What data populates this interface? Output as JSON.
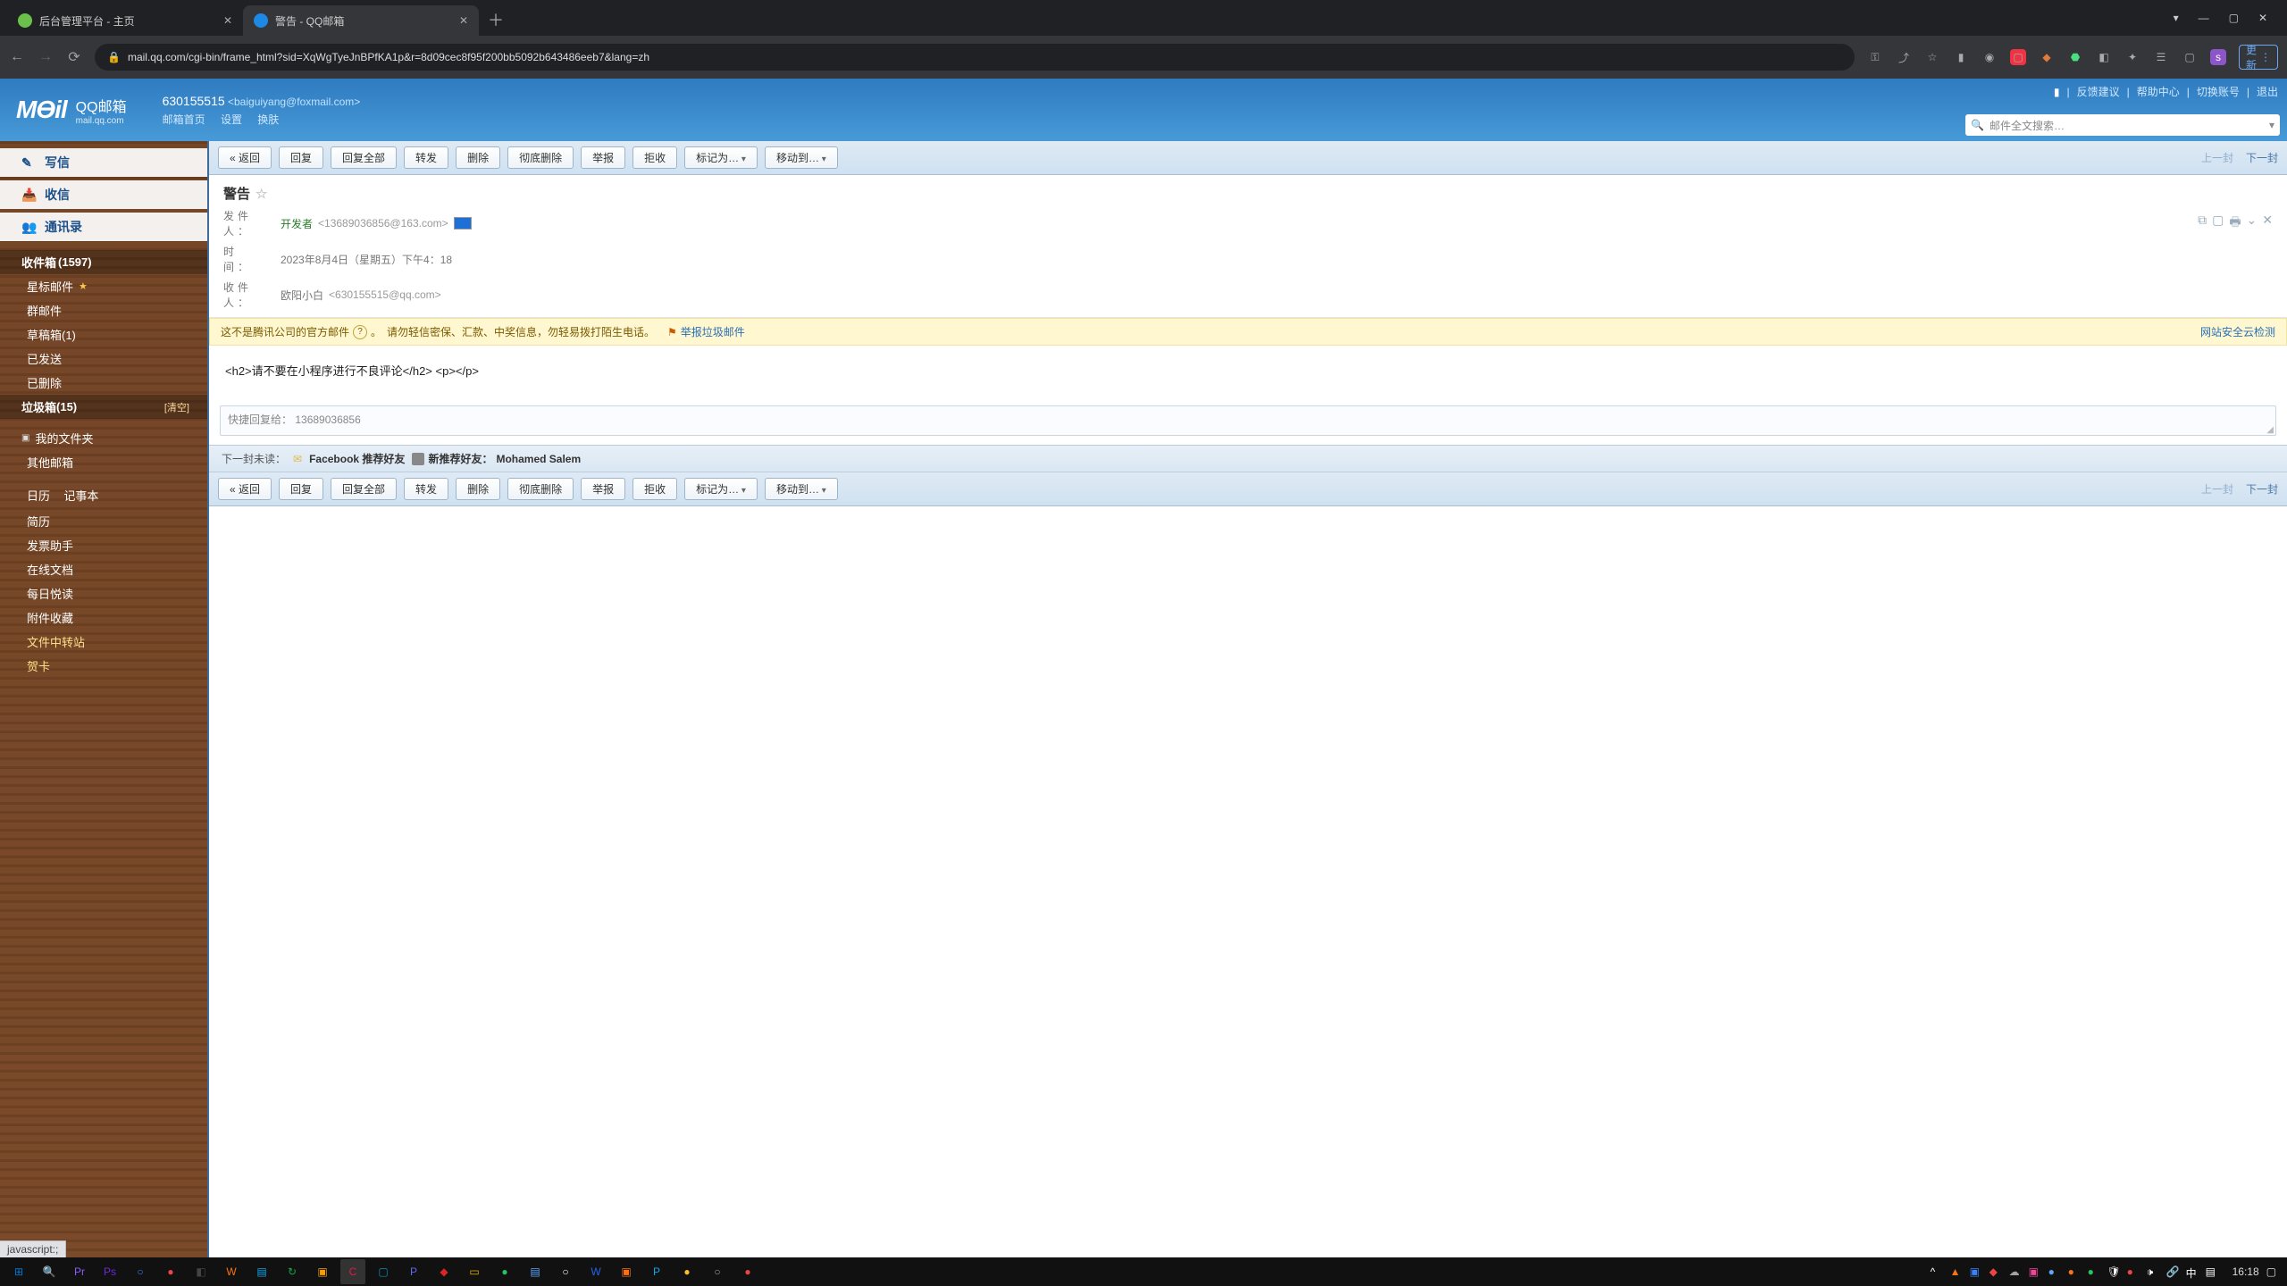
{
  "browser": {
    "tabs": [
      {
        "title": "后台管理平台 - 主页",
        "fav_color": "#6bc04b"
      },
      {
        "title": "警告 - QQ邮箱",
        "fav_color": "#1e88e5"
      }
    ],
    "active_tab": 1,
    "url": "mail.qq.com/cgi-bin/frame_html?sid=XqWgTyeJnBPfKA1p&r=8d09cec8f95f200bb5092b643486eeb7&lang=zh",
    "update_label": "更新",
    "avatar_letter": "s",
    "window_controls": {
      "min": "—",
      "max": "▢",
      "close": "✕",
      "menu": "▾"
    }
  },
  "qqheader": {
    "logo_main": "MƟil",
    "logo_cn": "QQ邮箱",
    "logo_sub": "mail.qq.com",
    "account_id": "630155515",
    "account_email": "<baiguiyang@foxmail.com>",
    "links": [
      "邮箱首页",
      "设置",
      "换肤"
    ],
    "right_links": [
      "反馈建议",
      "帮助中心",
      "切换账号",
      "退出"
    ],
    "search_placeholder": "邮件全文搜索…"
  },
  "sidebar": {
    "compose": "写信",
    "receive": "收信",
    "contacts": "通讯录",
    "inbox": {
      "label": "收件箱",
      "count": "(1597)"
    },
    "items": [
      {
        "label": "星标邮件",
        "star": true
      },
      {
        "label": "群邮件"
      },
      {
        "label": "草稿箱(1)"
      },
      {
        "label": "已发送"
      },
      {
        "label": "已删除"
      }
    ],
    "junk": {
      "label": "垃圾箱",
      "count": "(15)",
      "clear": "[清空]"
    },
    "myfolders": "我的文件夹",
    "other_mail": "其他邮箱",
    "calendar": "日历",
    "notes": "记事本",
    "links": [
      "简历",
      "发票助手",
      "在线文档",
      "每日悦读",
      "附件收藏",
      "文件中转站",
      "贺卡"
    ]
  },
  "toolbar": {
    "back": "« 返回",
    "buttons": [
      "回复",
      "回复全部",
      "转发",
      "删除",
      "彻底删除",
      "举报",
      "拒收"
    ],
    "mark": "标记为…",
    "move": "移动到…",
    "prev": "上一封",
    "next": "下一封"
  },
  "message": {
    "subject": "警告",
    "from_label": "发件人：",
    "from_name": "开发者",
    "from_addr": "<13689036856@163.com>",
    "date_label": "时　间：",
    "date": "2023年8月4日（星期五）下午4：18",
    "to_label": "收件人：",
    "to_name": "欧阳小白",
    "to_addr": "<630155515@qq.com>",
    "warn1": "这不是腾讯公司的官方邮件",
    "warn_q": "?",
    "warn2": "。　请勿轻信密保、汇款、中奖信息，勿轻易拨打陌生电话。",
    "warn_flag": "⚑",
    "warn_report": "举报垃圾邮件",
    "warn_right": "网站安全云检测",
    "body": "<h2>请不要在小程序进行不良评论</h2> <p></p>",
    "quick_reply_prefix": "快捷回复给：",
    "quick_reply_to": "13689036856",
    "next_unread_label": "下一封未读：",
    "next_unread_1": "Facebook 推荐好友",
    "next_unread_2_lbl": "新推荐好友：",
    "next_unread_2_name": "Mohamed Salem"
  },
  "statusbar": "javascript:;",
  "taskbar": {
    "apps": [
      {
        "c": "#0078d7",
        "t": "⊞"
      },
      {
        "c": "#fff",
        "t": "🔍"
      },
      {
        "c": "#8b5cf6",
        "t": "Pr"
      },
      {
        "c": "#6d28d9",
        "t": "Ps"
      },
      {
        "c": "#3b82f6",
        "t": "○"
      },
      {
        "c": "#ef4444",
        "t": "●"
      },
      {
        "c": "#444",
        "t": "◧"
      },
      {
        "c": "#f97316",
        "t": "W"
      },
      {
        "c": "#0ea5e9",
        "t": "▤"
      },
      {
        "c": "#16a34a",
        "t": "↻"
      },
      {
        "c": "#f59e0b",
        "t": "▣"
      },
      {
        "c": "#e11d48",
        "t": "C"
      },
      {
        "c": "#0891b2",
        "t": "▢"
      },
      {
        "c": "#6366f1",
        "t": "P"
      },
      {
        "c": "#dc2626",
        "t": "◆"
      },
      {
        "c": "#eab308",
        "t": "▭"
      },
      {
        "c": "#22c55e",
        "t": "●"
      },
      {
        "c": "#60a5fa",
        "t": "▤"
      },
      {
        "c": "#fff",
        "t": "○"
      },
      {
        "c": "#2563eb",
        "t": "W"
      },
      {
        "c": "#f97316",
        "t": "▣"
      },
      {
        "c": "#0ea5e9",
        "t": "P"
      },
      {
        "c": "#fbbf24",
        "t": "●"
      },
      {
        "c": "#a3a3a3",
        "t": "○"
      },
      {
        "c": "#ef4444",
        "t": "●"
      }
    ],
    "tray": [
      {
        "c": "#fff",
        "t": "^"
      },
      {
        "c": "#f97316",
        "t": "▲"
      },
      {
        "c": "#3b82f6",
        "t": "▣"
      },
      {
        "c": "#ef4444",
        "t": "◆"
      },
      {
        "c": "#a3a3a3",
        "t": "☁"
      },
      {
        "c": "#ec4899",
        "t": "▣"
      },
      {
        "c": "#60a5fa",
        "t": "●"
      },
      {
        "c": "#f97316",
        "t": "●"
      },
      {
        "c": "#22c55e",
        "t": "●"
      },
      {
        "c": "#fff",
        "t": "🛡"
      },
      {
        "c": "#ef4444",
        "t": "●"
      },
      {
        "c": "#fff",
        "t": "🕩"
      },
      {
        "c": "#fff",
        "t": "🔗"
      },
      {
        "c": "#fff",
        "t": "中"
      },
      {
        "c": "#fff",
        "t": "▤"
      }
    ],
    "time": "16:18"
  }
}
